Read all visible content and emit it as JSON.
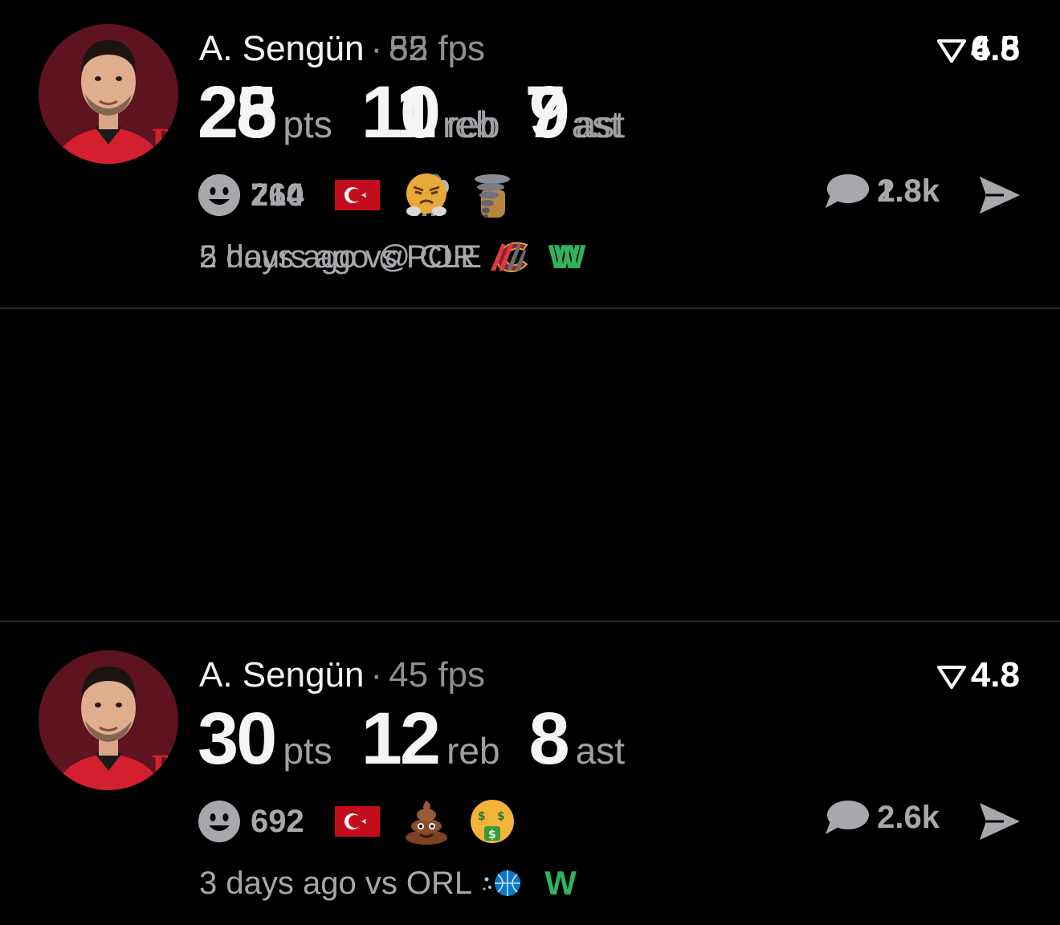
{
  "colors": {
    "background": "#000000",
    "text_primary": "#f5f5f5",
    "text_secondary": "#a7a7ac",
    "win": "#2fb35f",
    "flag_red": "#c40d1c",
    "avatar_bg": "#5e1320"
  },
  "posts": [
    {
      "player": "A. Sengün",
      "fps": "52 fps",
      "rating": "4.5",
      "stats": {
        "pts": "28",
        "reb": "11",
        "ast": "7"
      },
      "labels": {
        "pts": "pts",
        "reb": "reb",
        "ast": "ast"
      },
      "reactions": "264",
      "emojis": [
        "turkey-flag",
        "goat-emoji",
        "middle-finger-emoji"
      ],
      "comments": "2.3k",
      "time": "2 hours ago @ CLE",
      "opponent_logo": "cavaliers-logo",
      "result": "W"
    },
    {
      "player": "A. Sengün",
      "fps": "45 fps",
      "rating": "4.8",
      "stats": {
        "pts": "30",
        "reb": "12",
        "ast": "8"
      },
      "labels": {
        "pts": "pts",
        "reb": "reb",
        "ast": "ast"
      },
      "reactions": "692",
      "emojis": [
        "turkey-flag",
        "poop-emoji",
        "money-mouth-emoji"
      ],
      "comments": "2.6k",
      "time": "3 days ago vs ORL",
      "opponent_logo": "magic-logo",
      "result": "W"
    },
    {
      "player": "A. Sengün",
      "fps": "85 fps",
      "rating": "6.8",
      "stats": {
        "pts": "25",
        "reb": "10",
        "ast": "9"
      },
      "labels": {
        "pts": "pts",
        "reb": "reb",
        "ast": "ast"
      },
      "reactions": "710",
      "emojis": [
        "turkey-flag",
        "steaming-face-emoji",
        "tornado-emoji"
      ],
      "comments": "1.8k",
      "time": "5 days ago vs POR",
      "opponent_logo": "blazers-logo",
      "result": "W"
    }
  ]
}
